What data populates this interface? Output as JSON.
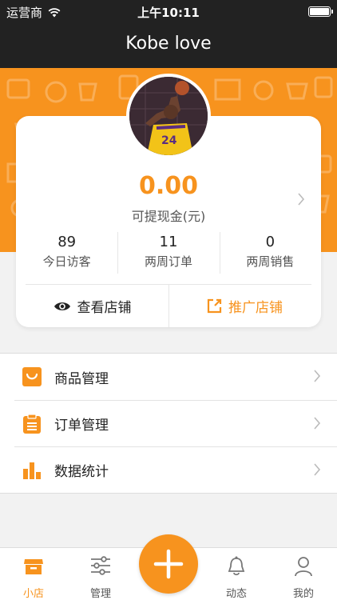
{
  "status_bar": {
    "carrier": "运营商",
    "time": "上午10:11"
  },
  "nav": {
    "title": "Kobe love"
  },
  "store": {
    "balance": "0.00",
    "balance_label": "可提现金(元)",
    "stats": [
      {
        "value": "89",
        "label": "今日访客"
      },
      {
        "value": "11",
        "label": "两周订单"
      },
      {
        "value": "0",
        "label": "两周销售"
      }
    ],
    "actions": {
      "view": "查看店铺",
      "promote": "推广店铺"
    }
  },
  "menu": [
    {
      "label": "商品管理",
      "icon": "bag-icon"
    },
    {
      "label": "订单管理",
      "icon": "clipboard-icon"
    },
    {
      "label": "数据统计",
      "icon": "bar-chart-icon"
    }
  ],
  "tabs": [
    {
      "label": "小店",
      "icon": "store-icon",
      "active": true
    },
    {
      "label": "管理",
      "icon": "sliders-icon",
      "active": false
    },
    {
      "label": "动态",
      "icon": "bell-icon",
      "active": false
    },
    {
      "label": "我的",
      "icon": "person-icon",
      "active": false
    }
  ],
  "colors": {
    "accent": "#f7931e",
    "dark": "#222222",
    "background": "#f2f2f2"
  }
}
